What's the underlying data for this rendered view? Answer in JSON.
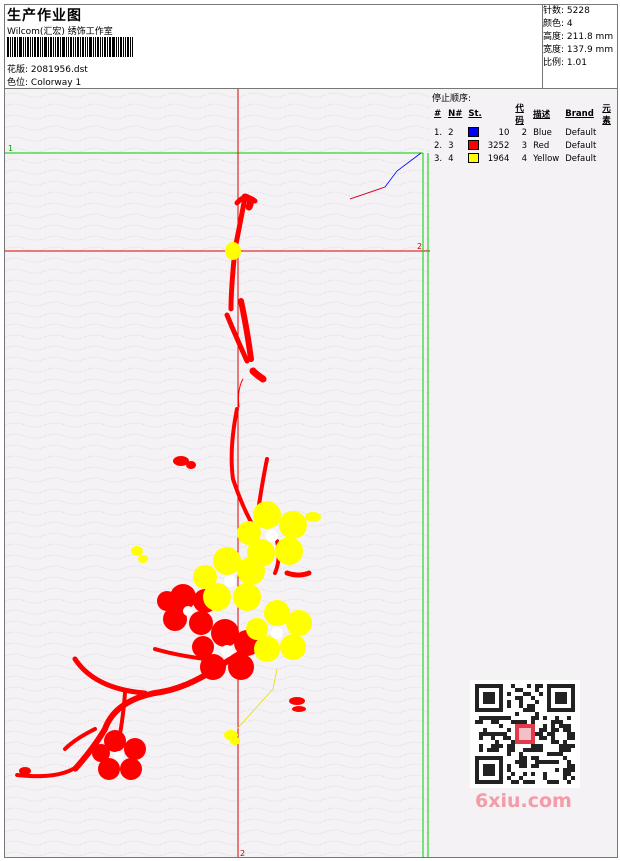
{
  "header": {
    "title": "生产作业图",
    "company": "Wilcom(汇宏) 绣饰工作室",
    "design_label": "花版:",
    "design_value": "2081956.dst",
    "colorway_label": "色位:",
    "colorway_value": "Colorway 1"
  },
  "stats": {
    "stitches_label": "针数:",
    "stitches_value": "5228",
    "colors_label": "颜色:",
    "colors_value": "4",
    "height_label": "高度:",
    "height_value": "211.8 mm",
    "width_label": "宽度:",
    "width_value": "137.9 mm",
    "scale_label": "比例:",
    "scale_value": "1.01"
  },
  "stop_sequence": {
    "title": "停止顺序:",
    "headers": [
      "#",
      "N#",
      "St.",
      "代码",
      "描述",
      "Brand",
      "元素"
    ],
    "rows": [
      {
        "idx": "1.",
        "n": "2",
        "color": "#0000ff",
        "st": "10",
        "code": "2",
        "desc": "Blue",
        "brand": "Default"
      },
      {
        "idx": "2.",
        "n": "3",
        "color": "#ff0000",
        "st": "3252",
        "code": "3",
        "desc": "Red",
        "brand": "Default"
      },
      {
        "idx": "3.",
        "n": "4",
        "color": "#ffff00",
        "st": "1964",
        "code": "4",
        "desc": "Yellow",
        "brand": "Default"
      }
    ]
  },
  "canvas": {
    "guide_labels": {
      "h1": "1",
      "h2": "2",
      "v2": "2"
    },
    "colors": {
      "red": "#ff0000",
      "yellow": "#ffff00",
      "blue": "#0000ff",
      "green": "#00cc00",
      "guide_red": "#e00000"
    }
  },
  "watermark": {
    "text": "6xiu.com"
  }
}
